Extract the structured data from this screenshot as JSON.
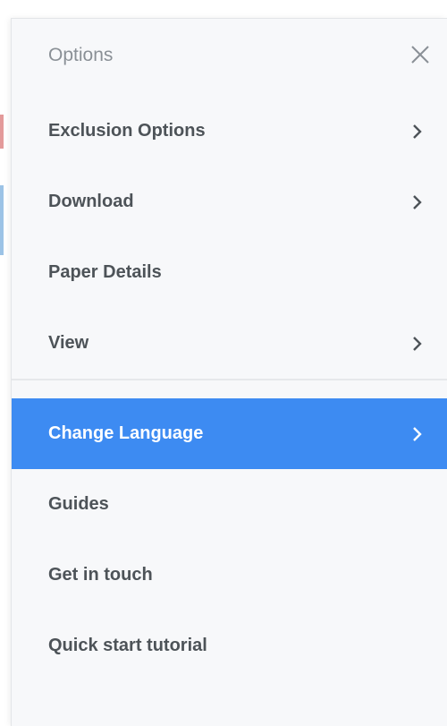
{
  "panel": {
    "title": "Options"
  },
  "menu": {
    "group_one": [
      {
        "label": "Exclusion Options",
        "has_chevron": true
      },
      {
        "label": "Download",
        "has_chevron": true
      },
      {
        "label": "Paper Details",
        "has_chevron": false
      },
      {
        "label": "View",
        "has_chevron": true
      }
    ],
    "group_two": [
      {
        "label": "Change Language",
        "has_chevron": true,
        "active": true
      },
      {
        "label": "Guides",
        "has_chevron": false
      },
      {
        "label": "Get in touch",
        "has_chevron": false
      },
      {
        "label": "Quick start tutorial",
        "has_chevron": false
      }
    ]
  },
  "icons": {
    "close": "close-icon",
    "chevron": "chevron-right-icon"
  },
  "colors": {
    "panel_bg": "#f7f8fa",
    "active_bg": "#3d8bf2",
    "text": "#4d5358",
    "title": "#8a9096"
  }
}
